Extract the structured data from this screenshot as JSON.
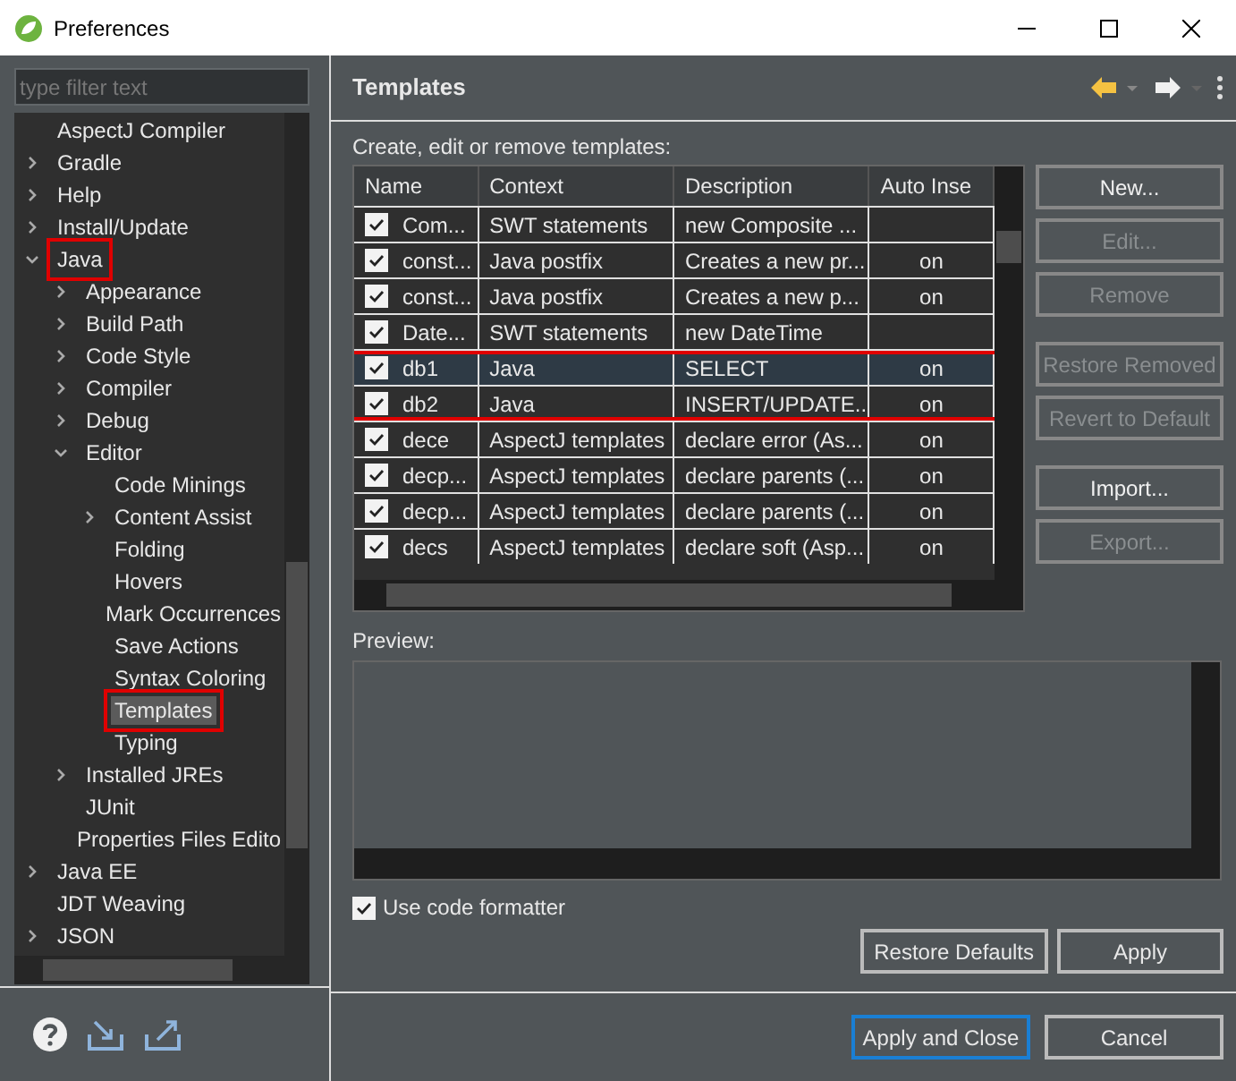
{
  "window": {
    "title": "Preferences"
  },
  "filter": {
    "placeholder": "type filter text"
  },
  "tree": [
    {
      "label": "AspectJ Compiler",
      "kind": "leaf",
      "selected": false,
      "highlighted": false
    },
    {
      "label": "Gradle",
      "kind": "branch",
      "expanded": false,
      "selected": false,
      "highlighted": false
    },
    {
      "label": "Help",
      "kind": "branch",
      "expanded": false,
      "selected": false,
      "highlighted": false
    },
    {
      "label": "Install/Update",
      "kind": "branch",
      "expanded": false,
      "selected": false,
      "highlighted": false
    },
    {
      "label": "Java",
      "kind": "branch",
      "expanded": true,
      "selected": false,
      "highlighted": true,
      "children": [
        {
          "label": "Appearance",
          "kind": "branch",
          "expanded": false,
          "selected": false,
          "highlighted": false
        },
        {
          "label": "Build Path",
          "kind": "branch",
          "expanded": false,
          "selected": false,
          "highlighted": false
        },
        {
          "label": "Code Style",
          "kind": "branch",
          "expanded": false,
          "selected": false,
          "highlighted": false
        },
        {
          "label": "Compiler",
          "kind": "branch",
          "expanded": false,
          "selected": false,
          "highlighted": false
        },
        {
          "label": "Debug",
          "kind": "branch",
          "expanded": false,
          "selected": false,
          "highlighted": false
        },
        {
          "label": "Editor",
          "kind": "branch",
          "expanded": true,
          "selected": false,
          "highlighted": false,
          "children": [
            {
              "label": "Code Minings",
              "kind": "leaf",
              "selected": false,
              "highlighted": false
            },
            {
              "label": "Content Assist",
              "kind": "branch",
              "expanded": false,
              "selected": false,
              "highlighted": false
            },
            {
              "label": "Folding",
              "kind": "leaf",
              "selected": false,
              "highlighted": false
            },
            {
              "label": "Hovers",
              "kind": "leaf",
              "selected": false,
              "highlighted": false
            },
            {
              "label": "Mark Occurrences",
              "kind": "leaf",
              "selected": false,
              "highlighted": false
            },
            {
              "label": "Save Actions",
              "kind": "leaf",
              "selected": false,
              "highlighted": false
            },
            {
              "label": "Syntax Coloring",
              "kind": "leaf",
              "selected": false,
              "highlighted": false
            },
            {
              "label": "Templates",
              "kind": "leaf",
              "selected": true,
              "highlighted": true
            },
            {
              "label": "Typing",
              "kind": "leaf",
              "selected": false,
              "highlighted": false
            }
          ]
        },
        {
          "label": "Installed JREs",
          "kind": "branch",
          "expanded": false,
          "selected": false,
          "highlighted": false
        },
        {
          "label": "JUnit",
          "kind": "leaf",
          "selected": false,
          "highlighted": false
        },
        {
          "label": "Properties Files Edito",
          "kind": "leaf",
          "selected": false,
          "highlighted": false
        }
      ]
    },
    {
      "label": "Java EE",
      "kind": "branch",
      "expanded": false,
      "selected": false,
      "highlighted": false
    },
    {
      "label": "JDT Weaving",
      "kind": "leaf",
      "selected": false,
      "highlighted": false
    },
    {
      "label": "JSON",
      "kind": "branch",
      "expanded": false,
      "selected": false,
      "highlighted": false
    }
  ],
  "page": {
    "title": "Templates",
    "intro": "Create, edit or remove templates:"
  },
  "table": {
    "columns": [
      "Name",
      "Context",
      "Description",
      "Auto Inse"
    ],
    "rows": [
      {
        "name": "Com...",
        "context": "SWT statements",
        "description": "new Composite ...",
        "auto_insert": "",
        "checked": true,
        "selected": false,
        "highlighted": false
      },
      {
        "name": "const...",
        "context": "Java postfix",
        "description": "Creates a new pr...",
        "auto_insert": "on",
        "checked": true,
        "selected": false,
        "highlighted": false
      },
      {
        "name": "const...",
        "context": "Java postfix",
        "description": "Creates a new p...",
        "auto_insert": "on",
        "checked": true,
        "selected": false,
        "highlighted": false
      },
      {
        "name": "Date...",
        "context": "SWT statements",
        "description": "new DateTime",
        "auto_insert": "",
        "checked": true,
        "selected": false,
        "highlighted": false
      },
      {
        "name": "db1",
        "context": "Java",
        "description": "SELECT",
        "auto_insert": "on",
        "checked": true,
        "selected": true,
        "highlighted": true
      },
      {
        "name": "db2",
        "context": "Java",
        "description": "INSERT/UPDATE...",
        "auto_insert": "on",
        "checked": true,
        "selected": false,
        "highlighted": true
      },
      {
        "name": "dece",
        "context": "AspectJ templates",
        "description": "declare error (As...",
        "auto_insert": "on",
        "checked": true,
        "selected": false,
        "highlighted": false
      },
      {
        "name": "decp...",
        "context": "AspectJ templates",
        "description": "declare parents (...",
        "auto_insert": "on",
        "checked": true,
        "selected": false,
        "highlighted": false
      },
      {
        "name": "decp...",
        "context": "AspectJ templates",
        "description": "declare parents (...",
        "auto_insert": "on",
        "checked": true,
        "selected": false,
        "highlighted": false
      },
      {
        "name": "decs",
        "context": "AspectJ templates",
        "description": "declare soft (Asp...",
        "auto_insert": "on",
        "checked": true,
        "selected": false,
        "highlighted": false
      }
    ]
  },
  "side_buttons": [
    {
      "label": "New...",
      "disabled": false
    },
    {
      "label": "Edit...",
      "disabled": true
    },
    {
      "label": "Remove",
      "disabled": true
    },
    {
      "label": "Restore Removed",
      "disabled": true
    },
    {
      "label": "Revert to Default",
      "disabled": true
    },
    {
      "label": "Import...",
      "disabled": false
    },
    {
      "label": "Export...",
      "disabled": true
    }
  ],
  "preview": {
    "label": "Preview:"
  },
  "formatter": {
    "label": "Use code formatter",
    "checked": true
  },
  "page_buttons": [
    "Restore Defaults",
    "Apply"
  ],
  "dialog_buttons": [
    {
      "label": "Apply and Close",
      "default": true
    },
    {
      "label": "Cancel",
      "default": false
    }
  ]
}
